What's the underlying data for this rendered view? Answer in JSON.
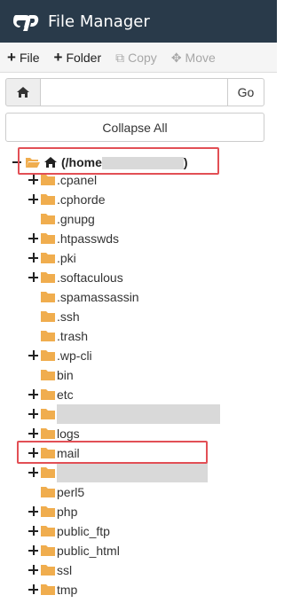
{
  "app": {
    "title": "File Manager",
    "logo": "cpanel-logo"
  },
  "toolbar": {
    "file_label": "File",
    "folder_label": "Folder",
    "copy_label": "Copy",
    "move_label": "Move"
  },
  "pathbar": {
    "value": "",
    "go_label": "Go"
  },
  "collapse_label": "Collapse All",
  "tree": {
    "root_label": "(/home",
    "root_suffix": ")",
    "items": [
      {
        "label": ".cpanel",
        "expandable": true
      },
      {
        "label": ".cphorde",
        "expandable": true
      },
      {
        "label": ".gnupg",
        "expandable": false
      },
      {
        "label": ".htpasswds",
        "expandable": true
      },
      {
        "label": ".pki",
        "expandable": true
      },
      {
        "label": ".softaculous",
        "expandable": true
      },
      {
        "label": ".spamassassin",
        "expandable": false
      },
      {
        "label": ".ssh",
        "expandable": false
      },
      {
        "label": ".trash",
        "expandable": false
      },
      {
        "label": ".wp-cli",
        "expandable": true
      },
      {
        "label": "bin",
        "expandable": false
      },
      {
        "label": "etc",
        "expandable": true
      },
      {
        "label": "",
        "expandable": true,
        "redacted": true
      },
      {
        "label": "logs",
        "expandable": true
      },
      {
        "label": "mail",
        "expandable": true
      },
      {
        "label": "",
        "expandable": true,
        "redacted": true
      },
      {
        "label": "perl5",
        "expandable": false
      },
      {
        "label": "php",
        "expandable": true
      },
      {
        "label": "public_ftp",
        "expandable": true
      },
      {
        "label": "public_html",
        "expandable": true
      },
      {
        "label": "ssl",
        "expandable": true
      },
      {
        "label": "tmp",
        "expandable": true
      }
    ]
  },
  "colors": {
    "titlebar": "#293a4a",
    "folder": "#f0ad4e",
    "highlight": "#e24f55"
  }
}
